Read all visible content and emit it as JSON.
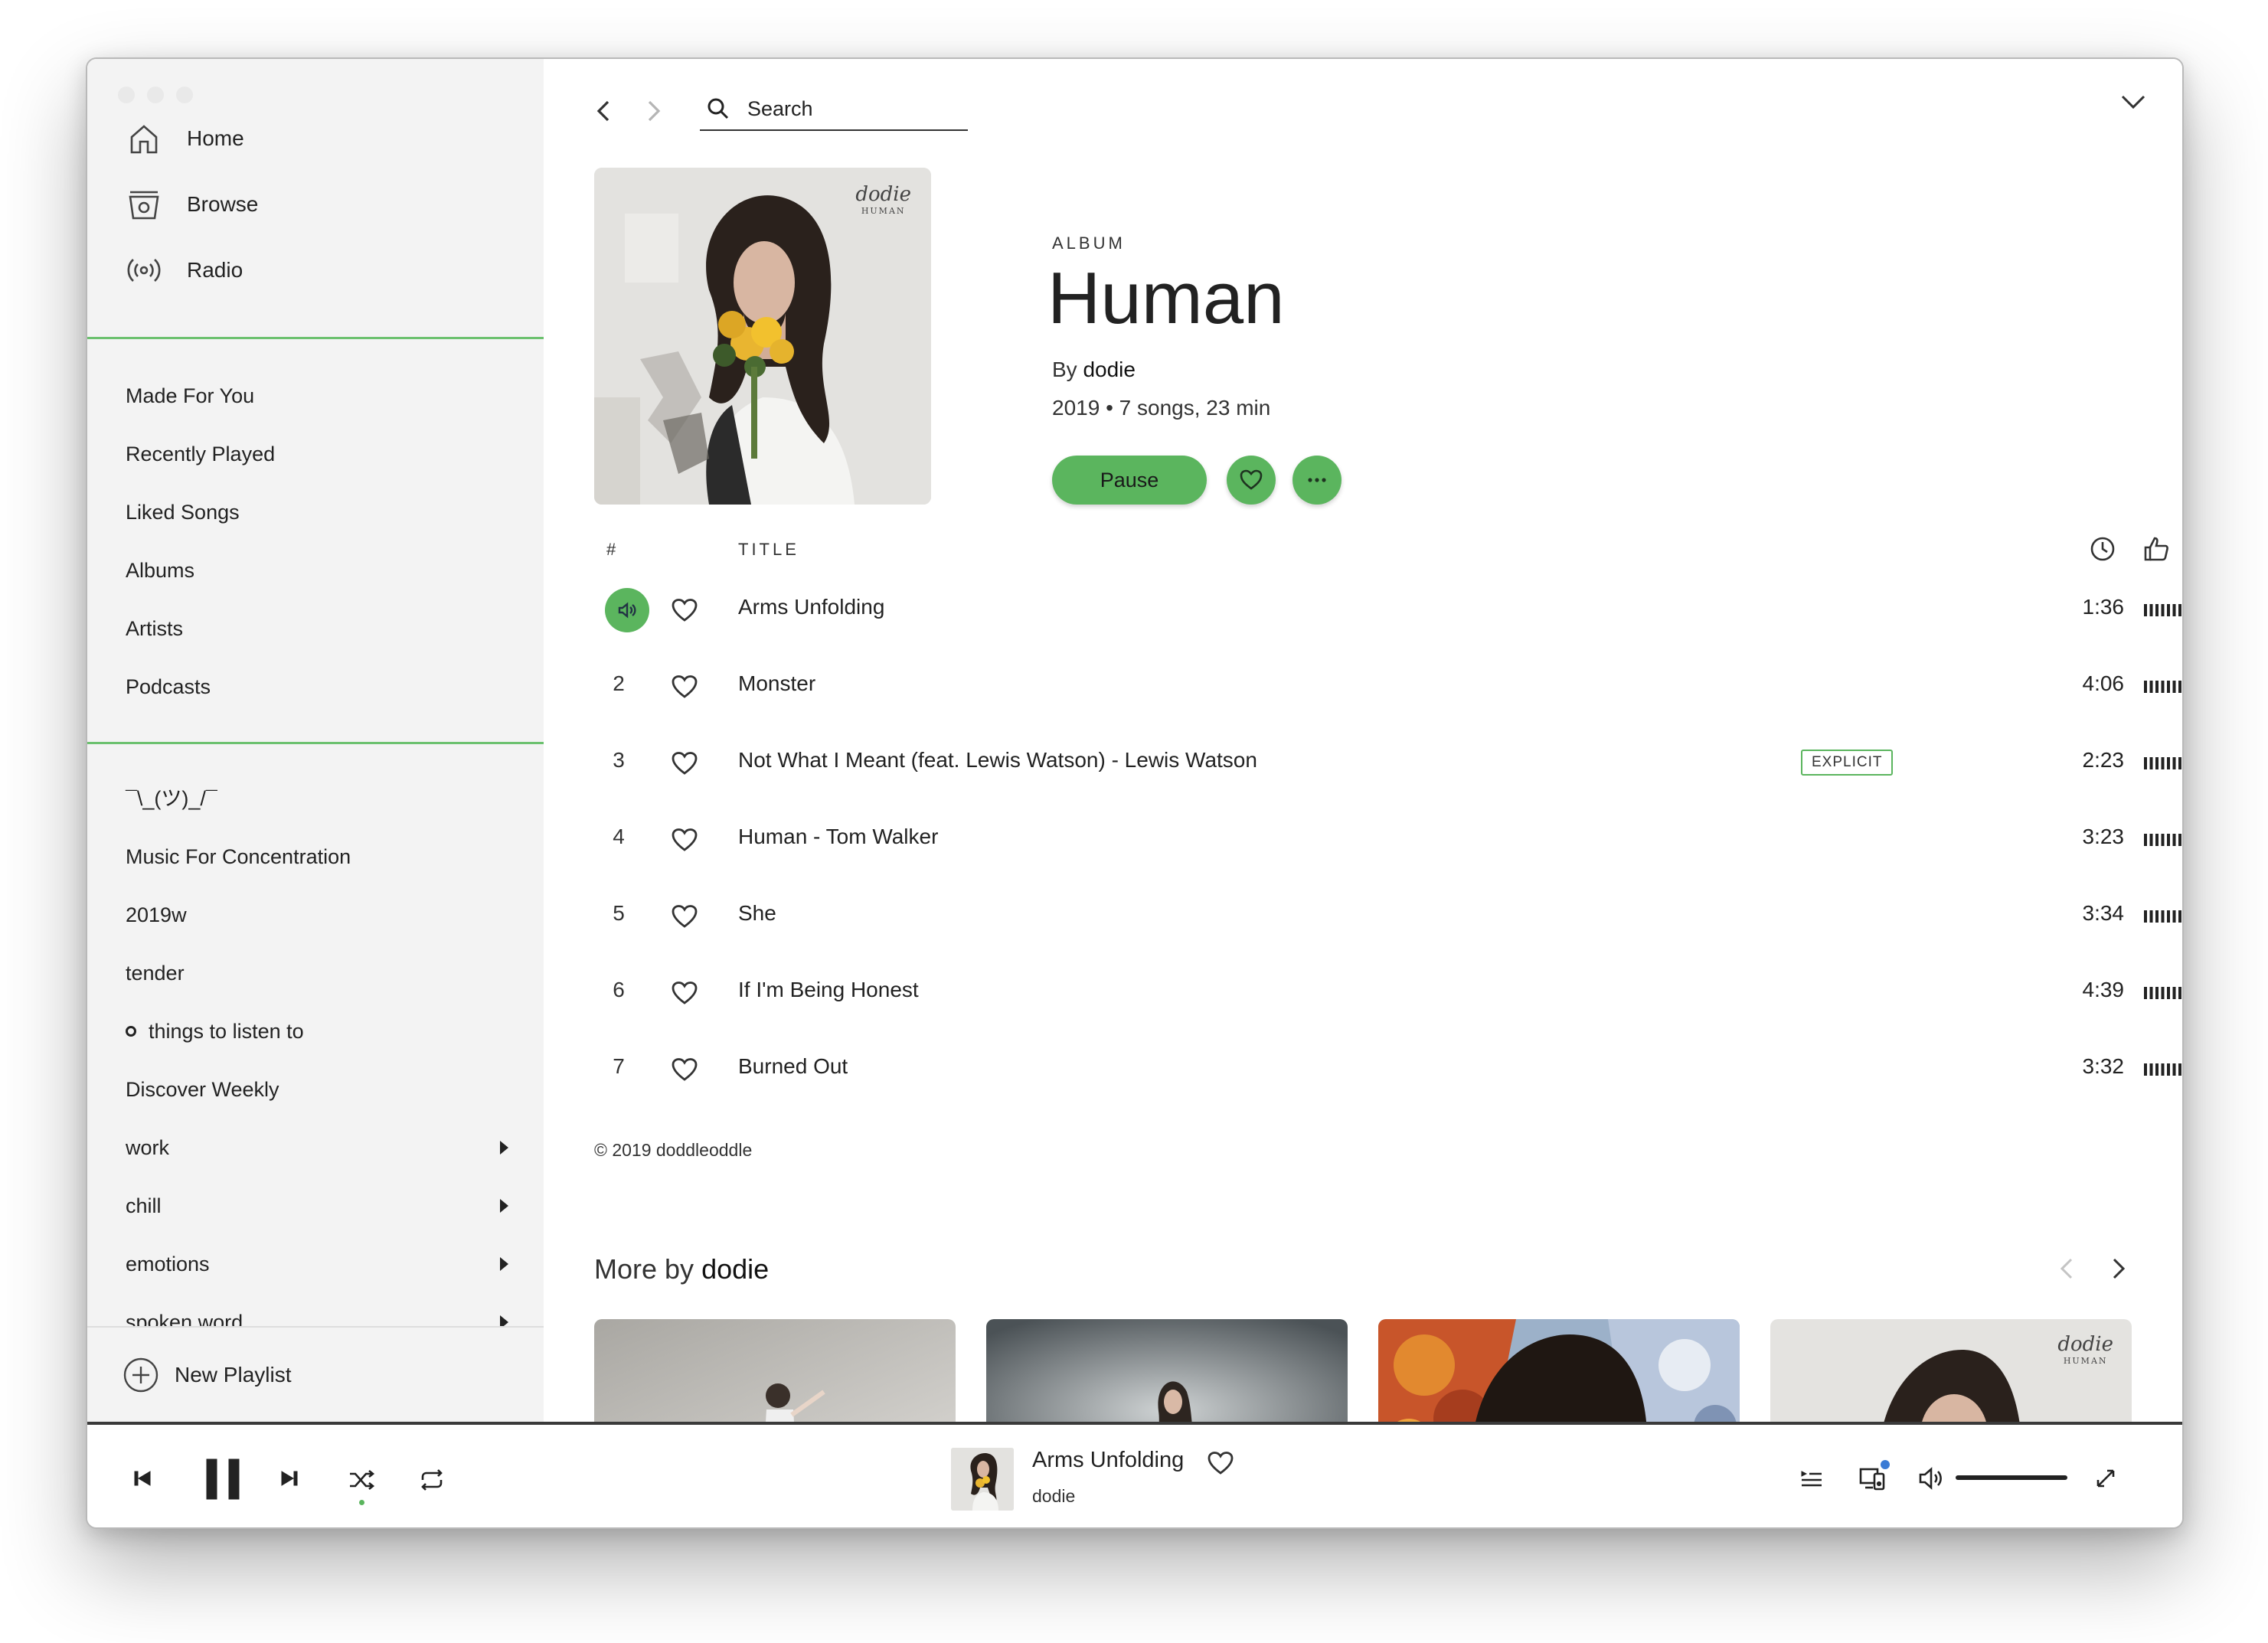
{
  "sidebar": {
    "nav": [
      {
        "label": "Home",
        "icon": "home-icon"
      },
      {
        "label": "Browse",
        "icon": "browse-icon"
      },
      {
        "label": "Radio",
        "icon": "radio-icon"
      }
    ],
    "library": [
      "Made For You",
      "Recently Played",
      "Liked Songs",
      "Albums",
      "Artists",
      "Podcasts"
    ],
    "playlists": [
      {
        "label": "¯\\_(ツ)_/¯"
      },
      {
        "label": "Music For Concentration"
      },
      {
        "label": "2019w"
      },
      {
        "label": "tender"
      },
      {
        "label": "things to listen to"
      },
      {
        "label": "Discover Weekly"
      },
      {
        "label": "work"
      },
      {
        "label": "chill"
      },
      {
        "label": "emotions"
      },
      {
        "label": "spoken word"
      }
    ],
    "new_playlist": "New Playlist"
  },
  "header": {
    "search_placeholder": "Search"
  },
  "album": {
    "kicker": "ALBUM",
    "title": "Human",
    "by_prefix": "By",
    "artist": "dodie",
    "meta": "2019 • 7 songs, 23 min",
    "pause_label": "Pause",
    "cover_text_artist": "dodie",
    "cover_text_title": "HUMAN"
  },
  "tracklist": {
    "col_num": "#",
    "col_title": "TITLE",
    "explicit_label": "EXPLICIT",
    "tracks": [
      {
        "num": "1",
        "title": "Arms Unfolding",
        "duration": "1:36",
        "playing": true,
        "explicit": false
      },
      {
        "num": "2",
        "title": "Monster",
        "duration": "4:06",
        "playing": false,
        "explicit": false
      },
      {
        "num": "3",
        "title": "Not What I Meant (feat. Lewis Watson) - Lewis Watson",
        "duration": "2:23",
        "playing": false,
        "explicit": true
      },
      {
        "num": "4",
        "title": "Human - Tom Walker",
        "duration": "3:23",
        "playing": false,
        "explicit": false
      },
      {
        "num": "5",
        "title": "She",
        "duration": "3:34",
        "playing": false,
        "explicit": false
      },
      {
        "num": "6",
        "title": "If I'm Being Honest",
        "duration": "4:39",
        "playing": false,
        "explicit": false
      },
      {
        "num": "7",
        "title": "Burned Out",
        "duration": "3:32",
        "playing": false,
        "explicit": false
      }
    ]
  },
  "copyright": "© 2019 doddleoddle",
  "more_by": {
    "prefix": "More by",
    "artist": "dodie",
    "thumb4_artist": "dodie",
    "thumb4_title": "HUMAN"
  },
  "now_playing": {
    "title": "Arms Unfolding",
    "artist": "dodie",
    "shuffle_active": true,
    "volume_fraction": 1.0
  },
  "colors": {
    "accent_green": "#5bb55e",
    "divider_green": "#6cc16f",
    "sidebar_bg": "#f3f3f3",
    "device_dot": "#3a7bd5"
  }
}
